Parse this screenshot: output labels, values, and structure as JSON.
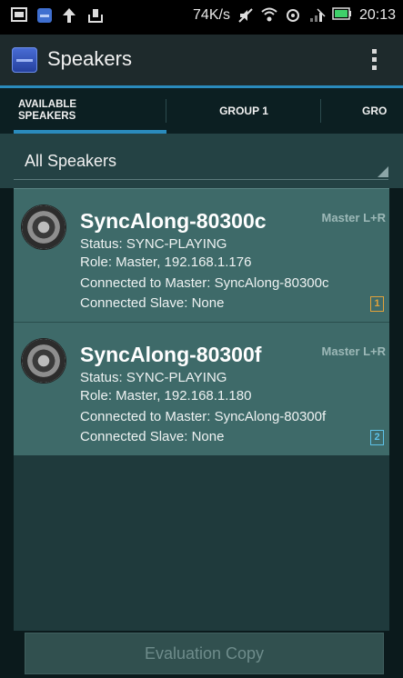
{
  "status_bar": {
    "net_speed": "74K/s",
    "time": "20:13"
  },
  "app_bar": {
    "title": "Speakers"
  },
  "tabs": [
    {
      "label": "AVAILABLE\nSPEAKERS",
      "selected": true
    },
    {
      "label": "GROUP 1",
      "selected": false
    },
    {
      "label": "GRO",
      "selected": false
    }
  ],
  "filter": {
    "selected": "All Speakers"
  },
  "speakers": [
    {
      "name": "SyncAlong-80300c",
      "status": "Status: SYNC-PLAYING",
      "role": "Role: Master,  192.168.1.176",
      "connected_master": "Connected to Master: SyncAlong-80300c",
      "connected_slave": "Connected Slave: None",
      "meta": "Master  L+R",
      "badge": "1"
    },
    {
      "name": "SyncAlong-80300f",
      "status": "Status: SYNC-PLAYING",
      "role": "Role: Master,  192.168.1.180",
      "connected_master": "Connected to Master: SyncAlong-80300f",
      "connected_slave": "Connected Slave: None",
      "meta": "Master  L+R",
      "badge": "2"
    }
  ],
  "footer_button": "Evaluation Copy",
  "colors": {
    "accent": "#2a8bbd",
    "card": "#3e6a69",
    "badge_orange": "#e2a23a",
    "badge_blue": "#5dc2e8"
  }
}
